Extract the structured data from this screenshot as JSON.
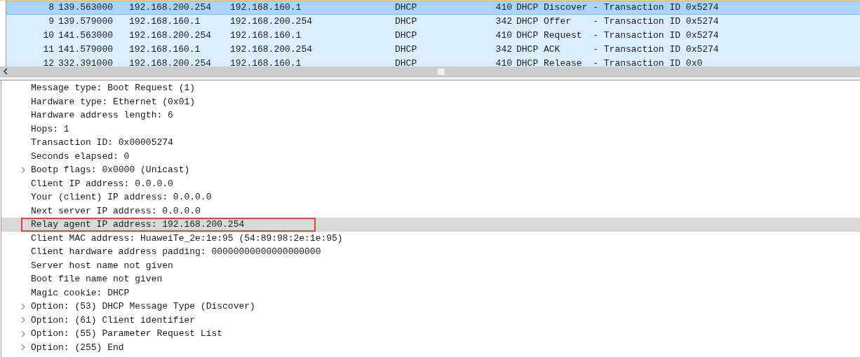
{
  "packet_list": {
    "rows": [
      {
        "no": "8",
        "time": "139.563000",
        "source": "192.168.200.254",
        "destination": "192.168.160.1",
        "protocol": "DHCP",
        "length": "410",
        "info": "DHCP Discover - Transaction ID 0x5274",
        "selected": true
      },
      {
        "no": "9",
        "time": "139.579000",
        "source": "192.168.160.1",
        "destination": "192.168.200.254",
        "protocol": "DHCP",
        "length": "342",
        "info": "DHCP Offer    - Transaction ID 0x5274",
        "selected": false
      },
      {
        "no": "10",
        "time": "141.563000",
        "source": "192.168.200.254",
        "destination": "192.168.160.1",
        "protocol": "DHCP",
        "length": "410",
        "info": "DHCP Request  - Transaction ID 0x5274",
        "selected": false
      },
      {
        "no": "11",
        "time": "141.579000",
        "source": "192.168.160.1",
        "destination": "192.168.200.254",
        "protocol": "DHCP",
        "length": "342",
        "info": "DHCP ACK      - Transaction ID 0x5274",
        "selected": false
      },
      {
        "no": "12",
        "time": "332.391000",
        "source": "192.168.200.254",
        "destination": "192.168.160.1",
        "protocol": "DHCP",
        "length": "410",
        "info": "DHCP Release  - Transaction ID 0x0",
        "selected": false
      }
    ]
  },
  "details": {
    "items": [
      {
        "text": "Message type: Boot Request (1)",
        "expandable": false,
        "selected": false,
        "annotated": false
      },
      {
        "text": "Hardware type: Ethernet (0x01)",
        "expandable": false,
        "selected": false,
        "annotated": false
      },
      {
        "text": "Hardware address length: 6",
        "expandable": false,
        "selected": false,
        "annotated": false
      },
      {
        "text": "Hops: 1",
        "expandable": false,
        "selected": false,
        "annotated": false
      },
      {
        "text": "Transaction ID: 0x00005274",
        "expandable": false,
        "selected": false,
        "annotated": false
      },
      {
        "text": "Seconds elapsed: 0",
        "expandable": false,
        "selected": false,
        "annotated": false
      },
      {
        "text": "Bootp flags: 0x0000 (Unicast)",
        "expandable": true,
        "selected": false,
        "annotated": false
      },
      {
        "text": "Client IP address: 0.0.0.0",
        "expandable": false,
        "selected": false,
        "annotated": false
      },
      {
        "text": "Your (client) IP address: 0.0.0.0",
        "expandable": false,
        "selected": false,
        "annotated": false
      },
      {
        "text": "Next server IP address: 0.0.0.0",
        "expandable": false,
        "selected": false,
        "annotated": false
      },
      {
        "text": "Relay agent IP address: 192.168.200.254",
        "expandable": false,
        "selected": true,
        "annotated": true
      },
      {
        "text": "Client MAC address: HuaweiTe_2e:1e:95 (54:89:98:2e:1e:95)",
        "expandable": false,
        "selected": false,
        "annotated": false
      },
      {
        "text": "Client hardware address padding: 00000000000000000000",
        "expandable": false,
        "selected": false,
        "annotated": false
      },
      {
        "text": "Server host name not given",
        "expandable": false,
        "selected": false,
        "annotated": false
      },
      {
        "text": "Boot file name not given",
        "expandable": false,
        "selected": false,
        "annotated": false
      },
      {
        "text": "Magic cookie: DHCP",
        "expandable": false,
        "selected": false,
        "annotated": false
      },
      {
        "text": "Option: (53) DHCP Message Type (Discover)",
        "expandable": true,
        "selected": false,
        "annotated": false
      },
      {
        "text": "Option: (61) Client identifier",
        "expandable": true,
        "selected": false,
        "annotated": false
      },
      {
        "text": "Option: (55) Parameter Request List",
        "expandable": true,
        "selected": false,
        "annotated": false
      },
      {
        "text": "Option: (255) End",
        "expandable": true,
        "selected": false,
        "annotated": false
      }
    ]
  }
}
